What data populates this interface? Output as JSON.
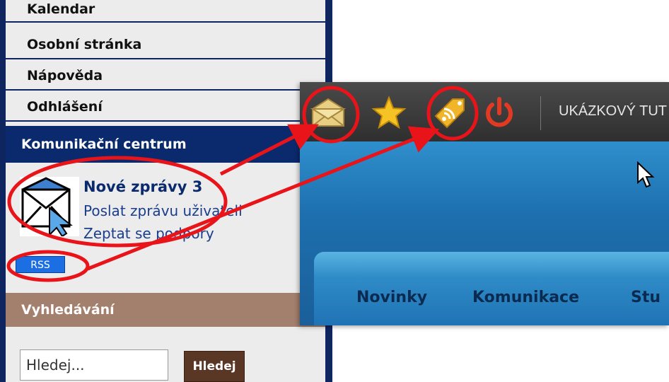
{
  "left_menu": {
    "items": [
      {
        "label": "Kalendar"
      },
      {
        "label": "Osobní stránka"
      },
      {
        "label": "Nápověda"
      },
      {
        "label": "Odhlášení"
      }
    ]
  },
  "communication": {
    "header": "Komunikační centrum",
    "new_messages": "Nové zprávy 3",
    "send_message": "Poslat zprávu uživateli",
    "ask_support": "Zeptat se podpory",
    "rss_label": "RSS"
  },
  "search": {
    "header": "Vyhledávání",
    "input_value": "Hledej...",
    "button_label": "Hledej"
  },
  "right_screenshot": {
    "toolbar_icons": [
      "envelope-icon",
      "star-icon",
      "rss-tag-icon",
      "power-icon"
    ],
    "title": "UKÁZKOVÝ TUT",
    "nav": [
      "Novinky",
      "Komunikace",
      "Stu"
    ]
  },
  "annotation_color": "#e8141a"
}
